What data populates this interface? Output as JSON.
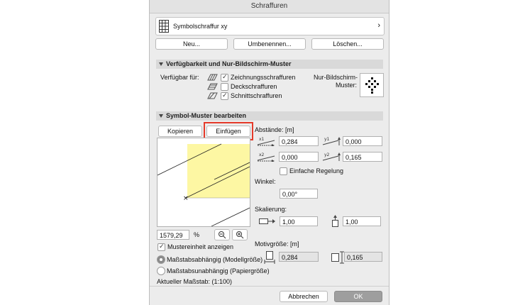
{
  "window": {
    "title": "Schraffuren"
  },
  "selector": {
    "value": "Symbolschraffur xy",
    "arrow": "›",
    "icon": "grid-pattern-icon"
  },
  "buttons": {
    "new": "Neu...",
    "rename": "Umbenennen...",
    "delete": "Löschen..."
  },
  "availability": {
    "header": "Verfügbarkeit und Nur-Bildschirm-Muster",
    "available_for_label": "Verfügbar für:",
    "options": [
      {
        "label": "Zeichnungsschraffuren",
        "checked": true
      },
      {
        "label": "Deckschraffuren",
        "checked": false
      },
      {
        "label": "Schnittschraffuren",
        "checked": true
      }
    ],
    "screen_pattern_label_line1": "Nur-Bildschirm-",
    "screen_pattern_label_line2": "Muster:"
  },
  "symbol_pattern": {
    "header": "Symbol-Muster bearbeiten",
    "copy_button": "Kopieren",
    "paste_button": "Einfügen",
    "zoom_value": "1579,29",
    "zoom_unit": "%",
    "show_unit_label": "Mustereinheit anzeigen",
    "show_unit_checked": true,
    "radio_scale_dependent": "Maßstabsabhängig (Modellgröße)",
    "radio_scale_independent": "Maßstabsunabhängig (Papiergröße)",
    "current_scale": "Aktueller Maßstab: (1:100)",
    "highlight_color": "#e53a2a"
  },
  "spacing": {
    "label": "Abstände: [m]",
    "x1": "0,284",
    "y1": "0,000",
    "x2": "0,000",
    "y2": "0,165",
    "x1_icon": "x1",
    "y1_icon": "y1",
    "x2_icon": "x2",
    "y2_icon": "y2",
    "simple_rule_label": "Einfache Regelung",
    "simple_rule_checked": false
  },
  "angle": {
    "label": "Winkel:",
    "value": "0,00°"
  },
  "scaling": {
    "label": "Skalierung:",
    "x": "1,00",
    "y": "1,00"
  },
  "motif": {
    "label": "Motivgröße: [m]",
    "width": "0,284",
    "height": "0,165"
  },
  "footer": {
    "cancel": "Abbrechen",
    "ok": "OK"
  }
}
